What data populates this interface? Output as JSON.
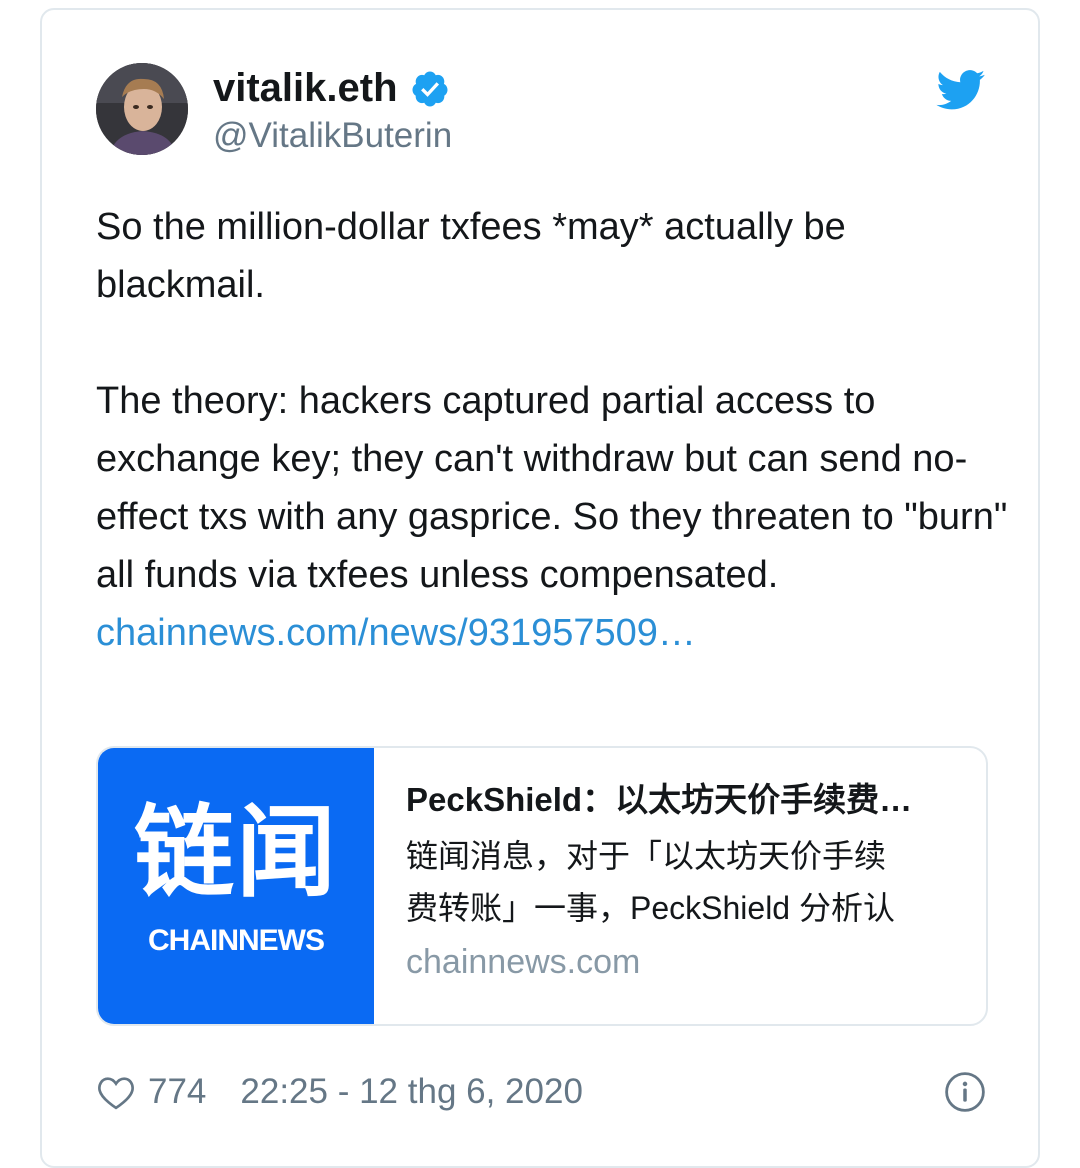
{
  "tweet": {
    "display_name": "vitalik.eth",
    "handle": "@VitalikButerin",
    "paragraph1": "So the million-dollar txfees *may* actually be blackmail.",
    "paragraph2": "The theory: hackers captured partial access to exchange key; they can't withdraw but can send no-effect txs with any gasprice. So they threaten to \"burn\" all funds via txfees unless compensated.",
    "link_text": "chainnews.com/news/931957509…",
    "like_count": "774",
    "timestamp": "22:25 - 12 thg 6, 2020"
  },
  "card": {
    "thumb_cn": "链闻",
    "thumb_en": "CHAINNEWS",
    "title": "PeckShield：以太坊天价手续费…",
    "desc_line1": "链闻消息，对于「以太坊天价手续",
    "desc_line2": "费转账」一事，PeckShield 分析认",
    "domain": "chainnews.com"
  },
  "icons": {
    "verified": "verified-badge-icon",
    "twitter": "twitter-bird-icon",
    "heart": "heart-icon",
    "info": "info-icon"
  },
  "colors": {
    "link": "#2b8fd6",
    "twitter_blue": "#1da1f2",
    "card_thumb": "#0a6af3"
  }
}
